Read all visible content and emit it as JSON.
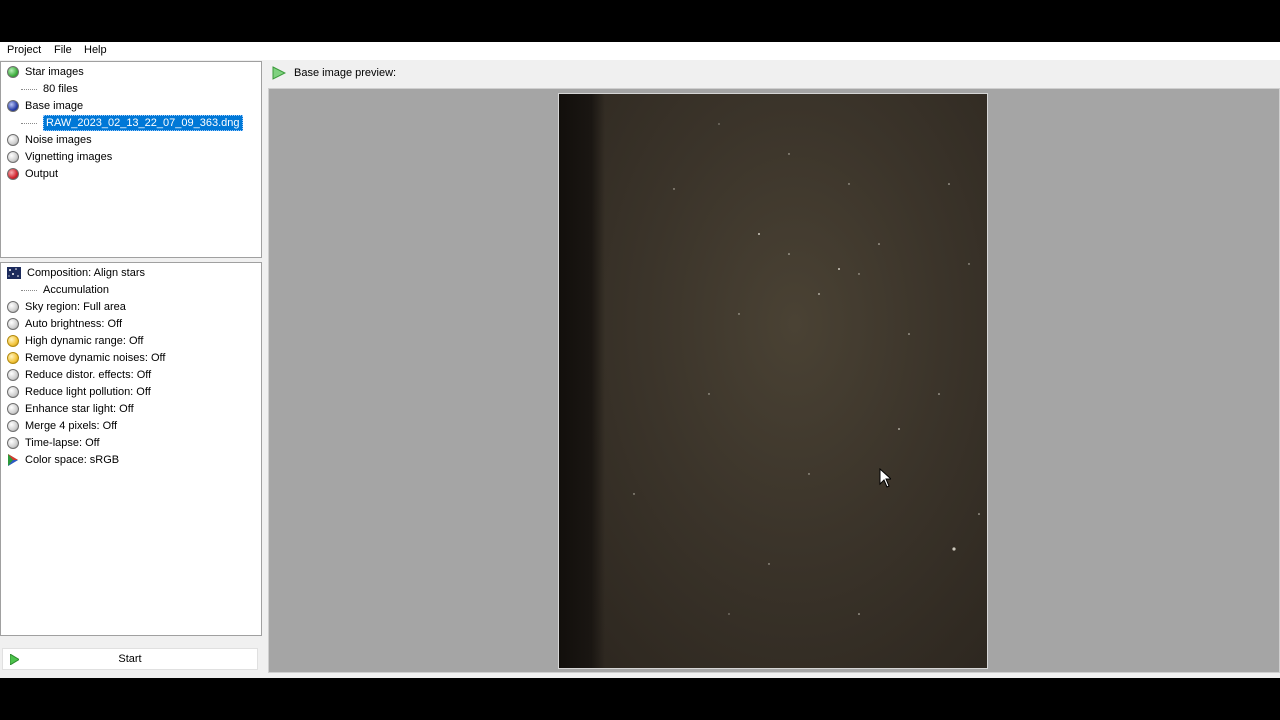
{
  "menu": [
    "Project",
    "File",
    "Help"
  ],
  "inputs_panel": {
    "items": [
      {
        "label": "Star images",
        "icon": "green-status-icon",
        "color": "#3fae3f"
      },
      {
        "label": "80 files",
        "child": true
      },
      {
        "label": "Base image",
        "icon": "blue-status-icon",
        "color": "#2a3fa8"
      },
      {
        "label": "RAW_2023_02_13_22_07_09_363.dng",
        "child": true,
        "selected": true
      },
      {
        "label": "Noise images",
        "icon": "gray-status-icon",
        "color": "#cfcfcf"
      },
      {
        "label": "Vignetting images",
        "icon": "gray-status-icon",
        "color": "#cfcfcf"
      },
      {
        "label": "Output",
        "icon": "red-status-icon",
        "color": "#d0262f"
      }
    ]
  },
  "settings_panel": {
    "items": [
      {
        "label": "Composition: Align stars",
        "icon": "stars-icon"
      },
      {
        "label": "Accumulation",
        "child": true
      },
      {
        "label": "Sky region: Full area",
        "icon": "gray-status-icon",
        "color": "#cfcfcf"
      },
      {
        "label": "Auto brightness: Off",
        "icon": "gray-status-icon",
        "color": "#cfcfcf"
      },
      {
        "label": "High dynamic range: Off",
        "icon": "yellow-status-icon",
        "color": "#f3c43a"
      },
      {
        "label": "Remove dynamic noises: Off",
        "icon": "yellow-status-icon",
        "color": "#f3c43a"
      },
      {
        "label": "Reduce distor. effects: Off",
        "icon": "gray-status-icon",
        "color": "#cfcfcf"
      },
      {
        "label": "Reduce light pollution: Off",
        "icon": "gray-status-icon",
        "color": "#cfcfcf"
      },
      {
        "label": "Enhance star light: Off",
        "icon": "gray-status-icon",
        "color": "#cfcfcf"
      },
      {
        "label": "Merge 4 pixels: Off",
        "icon": "gray-status-icon",
        "color": "#cfcfcf"
      },
      {
        "label": "Time-lapse: Off",
        "icon": "gray-status-icon",
        "color": "#cfcfcf"
      },
      {
        "label": "Color space: sRGB",
        "icon": "color-space-icon"
      }
    ]
  },
  "start_button": {
    "label": "Start",
    "icon": "play-icon"
  },
  "preview": {
    "title": "Base image preview:",
    "icon": "arrow-right-icon"
  }
}
